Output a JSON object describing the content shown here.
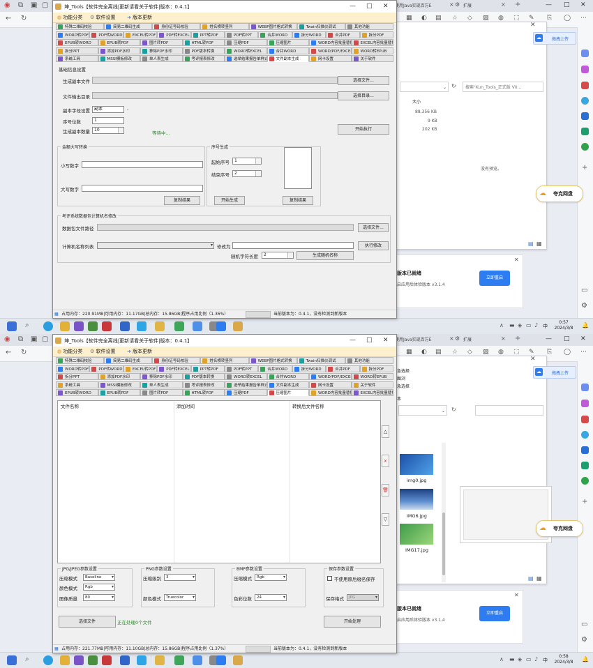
{
  "app": {
    "title": "坤_Tools【软件完全离线|更新请看关于软件|版本：0.4.1】",
    "menu": [
      "功能分类",
      "软件设置",
      "版本更新"
    ],
    "tabs_common": [
      [
        "特殊二维码校验",
        "简易二维码生成",
        "身份证号码校验",
        "姓名横转竖列",
        "WEBP图片格式转换",
        "Twain扫描仪调试",
        "其他功能"
      ],
      [
        "WORD转PDF",
        "PDF转WORD",
        "EXCEL转PDF",
        "PDF转EXCEL",
        "PPT转PDF",
        "PDF转PPT",
        "合并WORD",
        "拆分WORD",
        "合并PDF",
        "拆分PDF"
      ]
    ],
    "status_top": "占用内存：220.91MB|可用内存：11.17GB|总内存：15.86GB|程序占用比例（1.36%）",
    "status_bottom": "占用内存：221.77MB|可用内存：11.10GB|总内存：15.86GB|程序占用比例（1.37%）",
    "status_version": "当前版本为：0.4.1，没有检测到新版本"
  },
  "tabs_top": {
    "row3": [
      "EPUB转WORD",
      "EPUB转PDF",
      "图片转PDF",
      "HTML转PDF",
      "压缩PDF",
      "压缩图片",
      "WORD内容批量替换",
      "EXCEL内容批量替换"
    ],
    "row4": [
      "拆分PPT",
      "添加PDF水印",
      "移除PDF水印",
      "PDF版本转换",
      "WORD转EXCEL",
      "合并WORD",
      "WORD/PDF/EXCEL转图片",
      "WORD转EPUB"
    ],
    "row5": [
      "系统工具",
      "MSSI模板修改",
      "单人表生成",
      "考评报表修改",
      "选举结果报告单样式生成",
      "文件副本生成",
      "网卡设置",
      "关于软件"
    ]
  },
  "tabs_bottom": {
    "row3": [
      "拆分PPT",
      "添加PDF水印",
      "移除PDF水印",
      "PDF版本转换",
      "WORD转EXCEL",
      "合并WORD",
      "WORD/PDF/EXCEL转图片",
      "WORD转EPUB"
    ],
    "row4": [
      "系统工具",
      "MSSI模板修改",
      "单人表生成",
      "考评报表修改",
      "选举结果报告单样式生成",
      "文件副本生成",
      "网卡设置",
      "关于软件"
    ],
    "row5": [
      "EPUB转WORD",
      "EPUB转PDF",
      "图片转PDF",
      "HTML转PDF",
      "压缩PDF",
      "压缩图片",
      "WORD内容批量替换",
      "EXCEL内容批量替换"
    ]
  },
  "copy_panel": {
    "group_title": "基础信息设置",
    "gen_file_label": "生成副本文件",
    "select_file": "选择文件...",
    "output_label": "文件输出目录",
    "select_dir": "选择目录...",
    "field_label": "副本字段设置",
    "field_value": "副本",
    "field_suffix": "-",
    "seq_label": "序号位数",
    "seq_value": "1",
    "count_label": "生成副本数量",
    "count_value": "10",
    "waiting": "等待中...",
    "start": "开始执行"
  },
  "amount_panel": {
    "title": "金额大写转换",
    "small_label": "小写数字",
    "big_label": "大写数字",
    "copy": "复制结果"
  },
  "seq_panel": {
    "title": "序号生成",
    "start_label": "起始序号",
    "start_value": "1",
    "end_label": "结束序号",
    "end_value": "2",
    "gen": "开始生成",
    "copy": "复制结果"
  },
  "exam_panel": {
    "title": "考评系统数据包计算机名修改",
    "path_label": "数据包文件路径",
    "select_file": "选择文件...",
    "list_label": "计算机名称列表",
    "modify_label": "修改为",
    "exec": "执行修改",
    "rand_label": "随机字符长度",
    "rand_value": "2",
    "gen_rand": "生成随机名称"
  },
  "compress_panel": {
    "cols": [
      "文件名称",
      "添加时间",
      "转换后文件名称"
    ],
    "side_buttons": [
      "△",
      "x",
      "🗑",
      "▽"
    ],
    "jpg_title": "JPG/JPEG参数设置",
    "jpg_mode_label": "压缩模式",
    "jpg_mode": "Baseline",
    "jpg_color_label": "颜色模式",
    "jpg_color": "Rgb",
    "jpg_quality_label": "图像质量",
    "jpg_quality": "80",
    "png_title": "PNG参数设置",
    "png_level_label": "压缩级别",
    "png_level": "3",
    "png_color_label": "颜色模式",
    "png_color": "Truecolor",
    "bmp_title": "BMP参数设置",
    "bmp_mode_label": "压缩模式",
    "bmp_mode": "Rgb",
    "bmp_depth_label": "色彩位数",
    "bmp_depth": "24",
    "save_title": "保存参数设置",
    "keep_label": "不使用原后缀名保存",
    "save_fmt_label": "保存格式",
    "save_fmt": "JPG",
    "select_file": "选择文件",
    "processing": "正在处理0个文件",
    "start": "开始处理"
  },
  "explorer_top": {
    "search": "搜索\"Kun_Tools_正式版 V0...",
    "size_header": "大小",
    "sizes": [
      "88,356 KB",
      "9 KB",
      "202 KB"
    ],
    "no_preview": "没有预览。",
    "upload": "拖拽上传"
  },
  "explorer_bottom": {
    "side": [
      "急选择",
      "图浏",
      "急选择",
      "本"
    ],
    "files": [
      "img0.jpg",
      "IMG6.jpg",
      "IMG17.jpg"
    ],
    "upload": "拖拽上传"
  },
  "browser": {
    "tab_partial": "使用Java实现百万E",
    "tab_ext": "扩展",
    "notify_title": "版本已就绪",
    "notify_sub": "启应用后体验版本 v3.1.4",
    "notify_btn": "立即重启",
    "pill": "夸克网盘"
  },
  "clock_top": {
    "time": "0:57",
    "date": "2024/3/8"
  },
  "clock_bottom": {
    "time": "0:58",
    "date": "2024/3/8"
  },
  "tray_lang": "中",
  "colors": {
    "accent": "#2d7df0",
    "menu_bg": "#fdf0cf",
    "tab_selected": "#ffffff"
  }
}
